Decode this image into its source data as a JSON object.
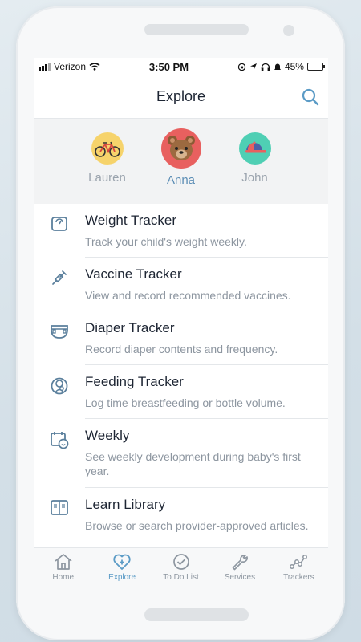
{
  "status_bar": {
    "carrier": "Verizon",
    "time": "3:50 PM",
    "battery": "45%",
    "battery_level": 0.45
  },
  "header": {
    "title": "Explore",
    "search_icon": "search-icon"
  },
  "profiles": [
    {
      "name": "Lauren",
      "icon": "bicycle-icon",
      "bg": "#f6d36b",
      "active": false
    },
    {
      "name": "Anna",
      "icon": "bear-icon",
      "bg": "#e8605f",
      "active": true
    },
    {
      "name": "John",
      "icon": "cap-icon",
      "bg": "#4fcfb4",
      "active": false
    }
  ],
  "trackers": [
    {
      "title": "Weight Tracker",
      "desc": "Track your child's weight weekly.",
      "icon": "scale-icon"
    },
    {
      "title": "Vaccine Tracker",
      "desc": "View and record recommended vaccines.",
      "icon": "syringe-icon"
    },
    {
      "title": "Diaper Tracker",
      "desc": "Record diaper contents and frequency.",
      "icon": "diaper-icon"
    },
    {
      "title": "Feeding Tracker",
      "desc": "Log time breastfeeding or bottle volume.",
      "icon": "bottle-icon"
    },
    {
      "title": "Weekly",
      "desc": "See weekly development during baby's first year.",
      "icon": "calendar-smile-icon"
    },
    {
      "title": "Learn Library",
      "desc": "Browse or search provider-approved articles.",
      "icon": "book-icon"
    }
  ],
  "tabbar": [
    {
      "label": "Home",
      "icon": "home-icon",
      "active": false
    },
    {
      "label": "Explore",
      "icon": "heart-plus-icon",
      "active": true
    },
    {
      "label": "To Do List",
      "icon": "check-circle-icon",
      "active": false
    },
    {
      "label": "Services",
      "icon": "wrench-icon",
      "active": false
    },
    {
      "label": "Trackers",
      "icon": "trend-icon",
      "active": false
    }
  ],
  "colors": {
    "accent": "#5b9bc6",
    "icon_stroke": "#5a7f9c",
    "text_primary": "#1d2533",
    "text_secondary": "#8d96a0"
  }
}
